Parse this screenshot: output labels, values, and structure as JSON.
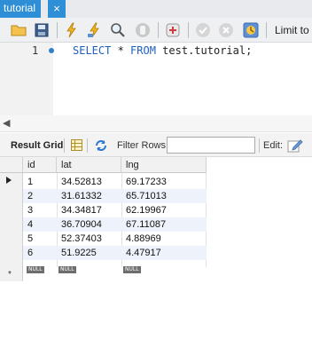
{
  "tab": {
    "title": "tutorial",
    "close_glyph": "×"
  },
  "toolbar": {
    "icons": [
      "folder-open-icon",
      "save-icon",
      "execute-lightning-icon",
      "execute-current-lightning-icon",
      "explain-magnifier-icon",
      "stop-icon",
      "toggle-continue-icon",
      "commit-icon",
      "rollback-icon",
      "autocommit-icon"
    ],
    "limit_label": "Limit to"
  },
  "editor": {
    "line_number": "1",
    "sql_keywords": [
      "SELECT",
      "FROM"
    ],
    "sql_parts": {
      "select": "SELECT",
      "star": " * ",
      "from": "FROM",
      "target": " test.tutorial;"
    }
  },
  "result_toolbar": {
    "result_grid_label": "Result Grid",
    "filter_label": "Filter Rows:",
    "filter_value": "",
    "edit_label": "Edit:"
  },
  "grid": {
    "columns": [
      "id",
      "lat",
      "lng"
    ],
    "rows": [
      [
        "1",
        "34.52813",
        "69.17233"
      ],
      [
        "2",
        "31.61332",
        "65.71013"
      ],
      [
        "3",
        "34.34817",
        "62.19967"
      ],
      [
        "4",
        "36.70904",
        "67.11087"
      ],
      [
        "5",
        "52.37403",
        "4.88969"
      ],
      [
        "6",
        "51.9225",
        "4.47917"
      ]
    ],
    "null_label": "NULL",
    "new_row_glyph": "*",
    "row_alt_color": "#eef3fb"
  },
  "colors": {
    "tab_active": "#2e8fd6",
    "sql_keyword": "#1f5fbf",
    "breakpoint_dot": "#2f7fd1"
  }
}
